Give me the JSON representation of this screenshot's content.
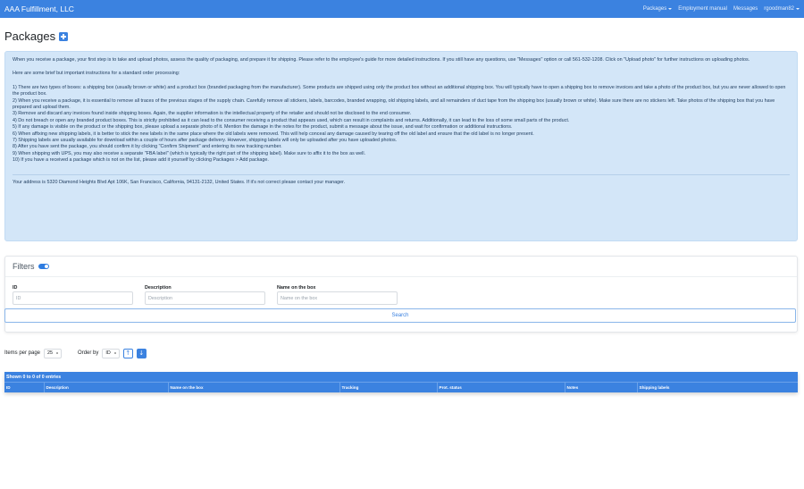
{
  "navbar": {
    "brand": "AAA Fulfillment, LLC",
    "links": [
      {
        "label": "Packages",
        "dropdown": true
      },
      {
        "label": "Employment manual",
        "dropdown": false
      },
      {
        "label": "Messages",
        "dropdown": false
      },
      {
        "label": "rgoodman82",
        "dropdown": true
      }
    ]
  },
  "page": {
    "title": "Packages",
    "add_icon": "plus-square-icon"
  },
  "info": {
    "intro": "When you receive a package, your first step is to take and upload photos, assess the quality of packaging, and prepare it for shipping. Please refer to the employee's guide for more detailed instructions. If you still have any questions, use \"Messages\" option or call 561-532-1208. Click on \"Upload photo\" for further instructions on uploading photos.",
    "subheading": "Here are some brief but important instructions for a standard order processing:",
    "items": [
      "1) There are two types of boxes: a shipping box (usually brown or white) and a product box (branded packaging from the manufacturer). Some products are shipped using only the product box without an additional shipping box. You will typically have to open a shipping box to remove invoices and take a photo of the product box, but you are never allowed to open the product box.",
      "2) When you receive a package, it is essential to remove all traces of the previous stages of the supply chain. Carefully remove all stickers, labels, barcodes, branded wrapping, old shipping labels, and all remainders of duct tape from the shipping box (usually brown or white). Make sure there are no stickers left. Take photos of the shipping box that you have prepared and upload them.",
      "3) Remove and discard any invoices found inside shipping boxes. Again, the supplier information is the intellectual property of the retailer and should not be disclosed to the end consumer.",
      "4) Do not breach or open any branded product boxes. This is strictly prohibited as it can lead to the consumer receiving a product that appears used, which can result in complaints and returns. Additionally, it can lead to the loss of some small parts of the product.",
      "5) If any damage is visible on the product or the shipping box, please upload a separate photo of it. Mention the damage in the notes for the product, submit a message about the issue, and wait for confirmation or additional instructions.",
      "6) When affixing new shipping labels, it is better to stick the new labels in the same place where the old labels were removed. This will help conceal any damage caused by tearing off the old label and ensure that the old label is no longer present.",
      "7) Shipping labels are usually available for download within a couple of hours after package delivery. However, shipping labels will only be uploaded after you have uploaded photos.",
      "8) After you have sent the package, you should confirm it by clicking \"Confirm Shipment\" and entering its new tracking number.",
      "9) When shipping with UPS, you may also receive a separate \"FBA label\" (which is typically the right part of the shipping label). Make sure to affix it to the box as well.",
      "10) If you have a received a package which is not on the list, please add it yourself by clicking Packages > Add package."
    ],
    "address": "Your address is 5320 Diamond Heights Blvd Apt 106K, San Francisco, California, 94131-2132, United States. If it's not correct please contact your manager."
  },
  "filters": {
    "title": "Filters",
    "toggle_on": true,
    "fields": [
      {
        "label": "ID",
        "placeholder": "ID"
      },
      {
        "label": "Description",
        "placeholder": "Description"
      },
      {
        "label": "Name on the box",
        "placeholder": "Name on the box"
      }
    ],
    "search_label": "Search"
  },
  "controls": {
    "items_per_page_label": "Items per page",
    "items_per_page_value": "25",
    "order_by_label": "Order by",
    "order_by_value": "ID",
    "sort_up_icon": "↑",
    "sort_down_icon": "↓"
  },
  "table": {
    "caption": "Shown 0 to 0 of 0 entries",
    "columns": [
      "ID",
      "Description",
      "Name on the box",
      "Tracking",
      "Prot. status",
      "Notes",
      "Shipping labels"
    ]
  },
  "colors": {
    "primary": "#3b82e0",
    "alert_bg": "#d3e6f8"
  }
}
